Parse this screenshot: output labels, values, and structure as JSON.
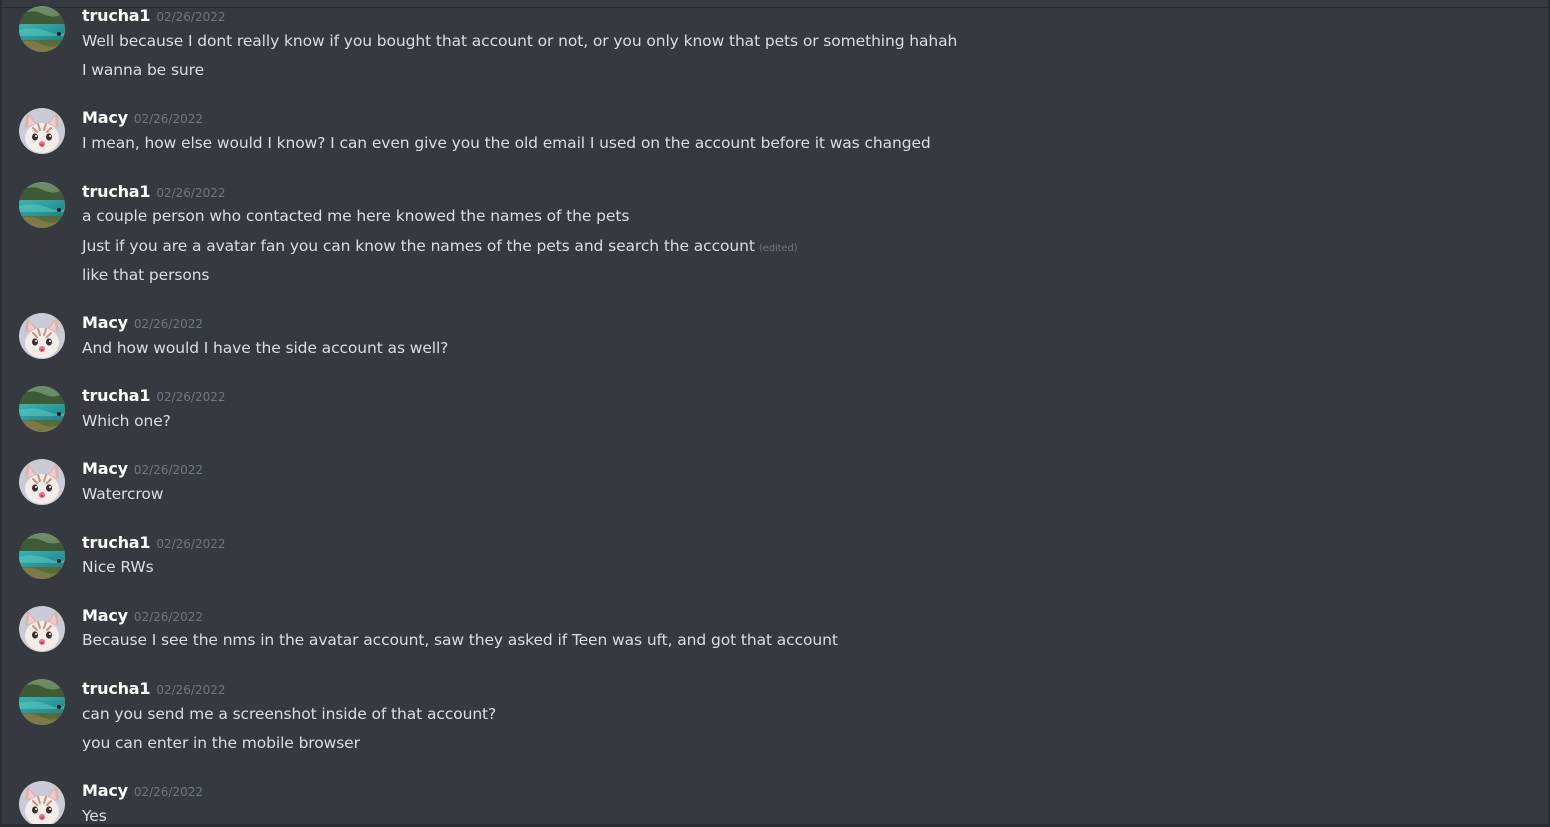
{
  "messages": [
    {
      "author": "trucha1",
      "avatar": "lake-photo-avatar",
      "timestamp": "02/26/2022",
      "lines": [
        {
          "text": "Well because I dont really know if you bought that account or not, or you only know that pets or something hahah"
        },
        {
          "text": "I wanna be sure"
        }
      ]
    },
    {
      "author": "Macy",
      "avatar": "cat-avatar",
      "timestamp": "02/26/2022",
      "lines": [
        {
          "text": "I mean, how else would I know? I can even give you the old email I used on the account before it was changed"
        }
      ]
    },
    {
      "author": "trucha1",
      "avatar": "lake-photo-avatar",
      "timestamp": "02/26/2022",
      "lines": [
        {
          "text": "a couple person who contacted me here knowed the names of the pets"
        },
        {
          "text": "Just if you are a avatar fan you can know the names of the pets and search the account",
          "edited": "(edited)"
        },
        {
          "text": "like that persons"
        }
      ]
    },
    {
      "author": "Macy",
      "avatar": "cat-avatar",
      "timestamp": "02/26/2022",
      "lines": [
        {
          "text": "And how would I have the side account as well?"
        }
      ]
    },
    {
      "author": "trucha1",
      "avatar": "lake-photo-avatar",
      "timestamp": "02/26/2022",
      "lines": [
        {
          "text": "Which one?"
        }
      ]
    },
    {
      "author": "Macy",
      "avatar": "cat-avatar",
      "timestamp": "02/26/2022",
      "lines": [
        {
          "text": "Watercrow"
        }
      ]
    },
    {
      "author": "trucha1",
      "avatar": "lake-photo-avatar",
      "timestamp": "02/26/2022",
      "lines": [
        {
          "text": "Nice RWs"
        }
      ]
    },
    {
      "author": "Macy",
      "avatar": "cat-avatar",
      "timestamp": "02/26/2022",
      "lines": [
        {
          "text": "Because I see the nms in the avatar account,  saw they asked if Teen was uft, and got that account"
        }
      ]
    },
    {
      "author": "trucha1",
      "avatar": "lake-photo-avatar",
      "timestamp": "02/26/2022",
      "lines": [
        {
          "text": "can you send me a screenshot inside of that account?"
        },
        {
          "text": "you can enter in the mobile browser"
        }
      ]
    },
    {
      "author": "Macy",
      "avatar": "cat-avatar",
      "timestamp": "02/26/2022",
      "lines": [
        {
          "text": "Yes"
        }
      ]
    }
  ],
  "colors": {
    "background": "#36393f",
    "username": "#ffffff",
    "text": "#dcddde",
    "muted": "#72767d"
  }
}
